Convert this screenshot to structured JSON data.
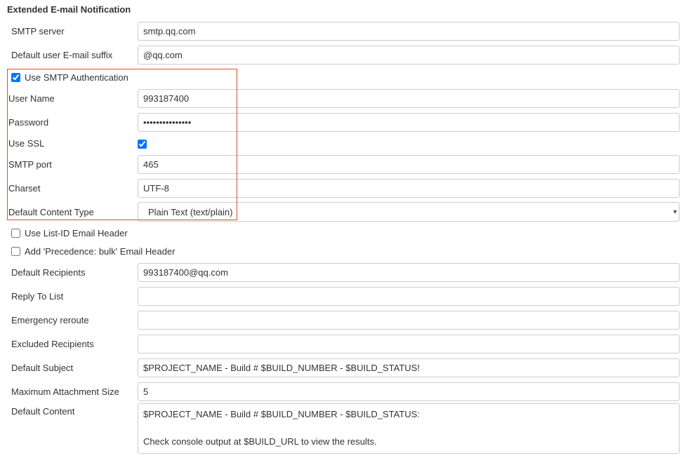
{
  "section_title": "Extended E-mail Notification",
  "fields": {
    "smtp_server": {
      "label": "SMTP server",
      "value": "smtp.qq.com"
    },
    "default_suffix": {
      "label": "Default user E-mail suffix",
      "value": "@qq.com"
    },
    "use_smtp_auth": {
      "label": "Use SMTP Authentication"
    },
    "user_name": {
      "label": "User Name",
      "value": "993187400"
    },
    "password": {
      "label": "Password",
      "value": "•••••••••••••••"
    },
    "use_ssl": {
      "label": "Use SSL"
    },
    "smtp_port": {
      "label": "SMTP port",
      "value": "465"
    },
    "charset": {
      "label": "Charset",
      "value": "UTF-8"
    },
    "default_content_type": {
      "label": "Default Content Type",
      "value": "Plain Text (text/plain)"
    },
    "use_list_id": {
      "label": "Use List-ID Email Header"
    },
    "add_precedence": {
      "label": "Add 'Precedence: bulk' Email Header"
    },
    "default_recipients": {
      "label": "Default Recipients",
      "value": "993187400@qq.com"
    },
    "reply_to_list": {
      "label": "Reply To List",
      "value": ""
    },
    "emergency_reroute": {
      "label": "Emergency reroute",
      "value": ""
    },
    "excluded_recipients": {
      "label": "Excluded Recipients",
      "value": ""
    },
    "default_subject": {
      "label": "Default Subject",
      "value": "$PROJECT_NAME - Build # $BUILD_NUMBER - $BUILD_STATUS!"
    },
    "max_attachment_size": {
      "label": "Maximum Attachment Size",
      "value": "5"
    },
    "default_content": {
      "label": "Default Content",
      "value": "$PROJECT_NAME - Build # $BUILD_NUMBER - $BUILD_STATUS:\n\nCheck console output at $BUILD_URL to view the results."
    }
  }
}
